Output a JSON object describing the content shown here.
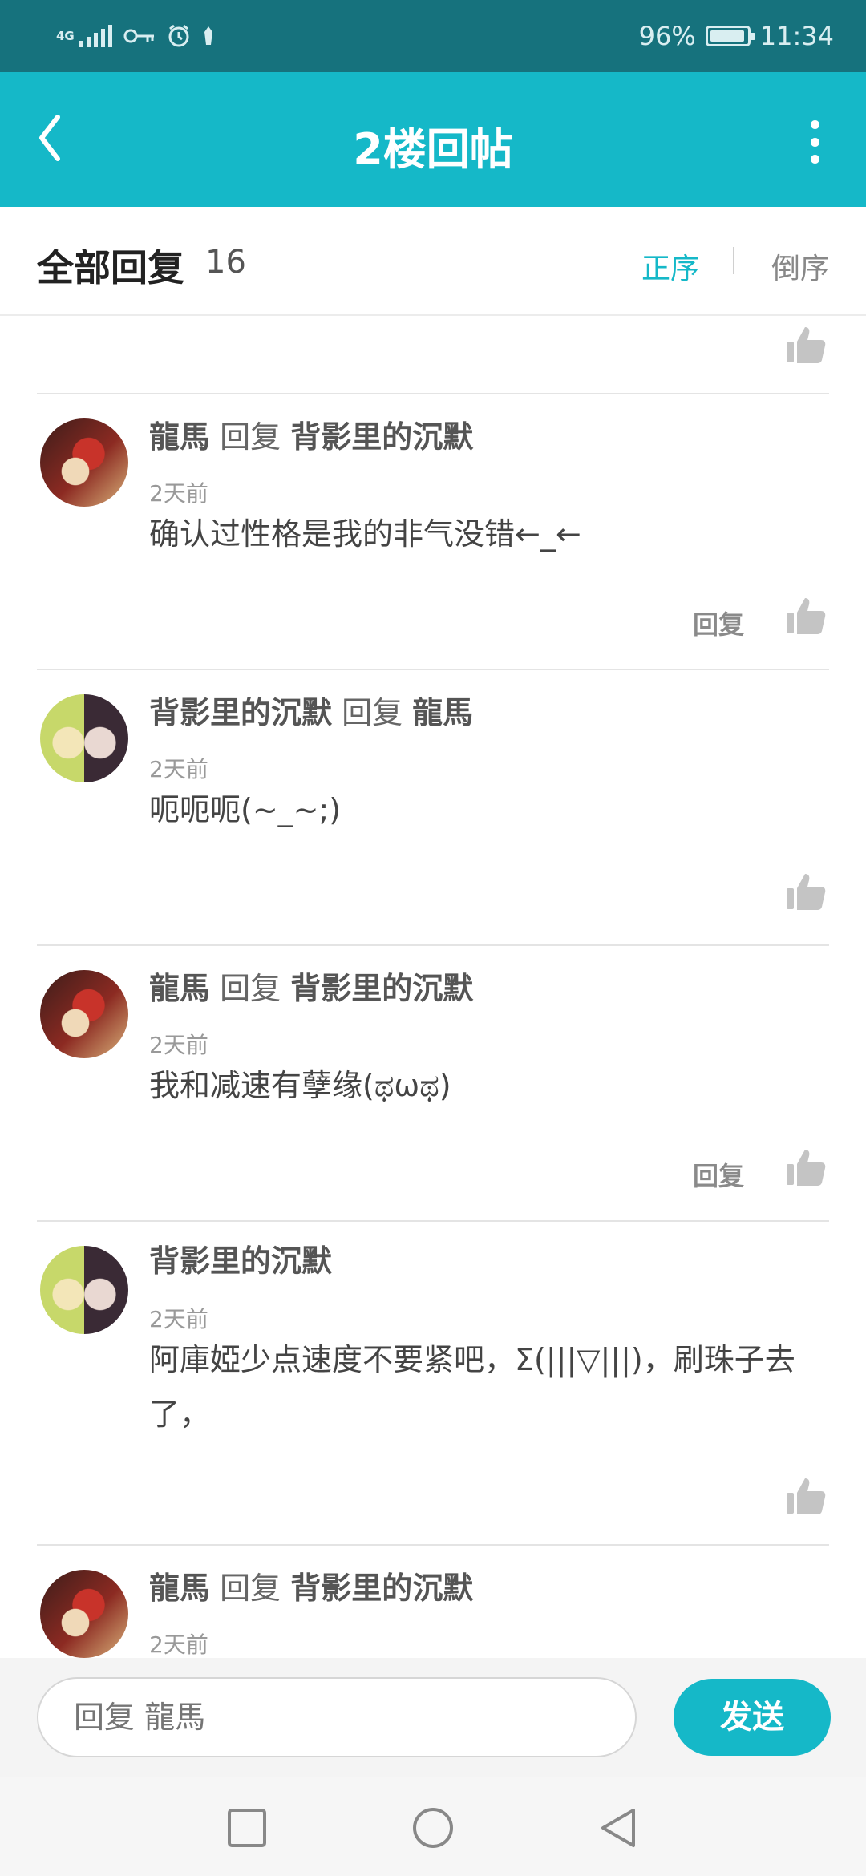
{
  "status_bar": {
    "network": "4G",
    "battery": "96%",
    "battery_level": 0.96,
    "time": "11:34",
    "icons": [
      "signal-icon",
      "key-icon",
      "alarm-icon",
      "notification-icon",
      "battery-icon"
    ]
  },
  "titlebar": {
    "title": "2楼回帖",
    "back_icon": "chevron-left-icon",
    "more_icon": "more-vertical-icon"
  },
  "header": {
    "title": "全部回复",
    "count": "16",
    "sort_asc": "正序",
    "sort_desc": "倒序",
    "active_sort": "正序"
  },
  "replies": [
    {
      "author": "龍馬",
      "reply_word": "回复",
      "reply_to": "背影里的沉默",
      "time": "2天前",
      "content": "确认过性格是我的非气没错←_←",
      "reply_label": "回复"
    },
    {
      "author": "背影里的沉默",
      "reply_word": "回复",
      "reply_to": "龍馬",
      "time": "2天前",
      "content": "呃呃呃(~_~;)"
    },
    {
      "author": "龍馬",
      "reply_word": "回复",
      "reply_to": "背影里的沉默",
      "time": "2天前",
      "content": "我和减速有孽缘(ಥωಥ)",
      "reply_label": "回复"
    },
    {
      "author": "背影里的沉默",
      "time": "2天前",
      "content": "阿庫婭少点速度不要紧吧，Σ(|||▽|||)，刷珠子去了，"
    },
    {
      "author": "龍馬",
      "reply_word": "回复",
      "reply_to": "背影里的沉默",
      "time": "2天前"
    }
  ],
  "input_bar": {
    "placeholder": "回复 龍馬",
    "send_label": "发送"
  },
  "nav_bar": {
    "icons": [
      "recent-apps-icon",
      "home-icon",
      "back-icon"
    ]
  },
  "colors": {
    "status_bar": "#16727d",
    "accent": "#15b8c8"
  }
}
